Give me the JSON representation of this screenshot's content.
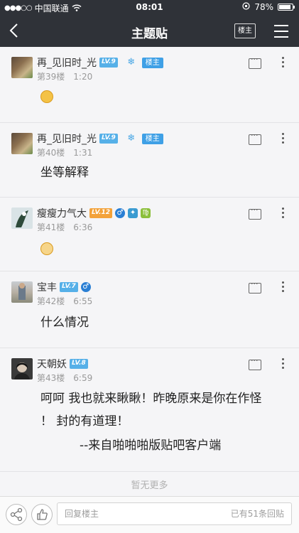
{
  "status": {
    "carrier": "中国联通",
    "time": "08:01",
    "battery_text": "78%",
    "battery_level": 0.78
  },
  "nav": {
    "title": "主题贴",
    "louzhu_label": "楼主"
  },
  "posts": [
    {
      "name": "再_见旧时_光",
      "level": "LV.9",
      "owner_badge": "楼主",
      "floor": "第39楼",
      "time": "1:20",
      "content": ""
    },
    {
      "name": "再_见旧时_光",
      "level": "LV.9",
      "owner_badge": "楼主",
      "floor": "第40楼",
      "time": "1:31",
      "content": "坐等解释"
    },
    {
      "name": "瘦瘦力气大",
      "level": "LV.12",
      "floor": "第41楼",
      "time": "6:36",
      "content": ""
    },
    {
      "name": "宝丰",
      "level": "LV.7",
      "floor": "第42楼",
      "time": "6:55",
      "content": "什么情况"
    },
    {
      "name": "天朝妖",
      "level": "LV.8",
      "floor": "第43楼",
      "time": "6:59",
      "content_line1": "呵呵 我也就来瞅瞅！昨晚原来是你在作怪",
      "content_line2": "！ 封的有道理！",
      "content_line3": "--来自啪啪啪版贴吧客户端"
    }
  ],
  "footer": {
    "no_more": "暂无更多"
  },
  "bottom": {
    "reply_placeholder": "回复楼主",
    "reply_count": "已有51条回贴"
  }
}
